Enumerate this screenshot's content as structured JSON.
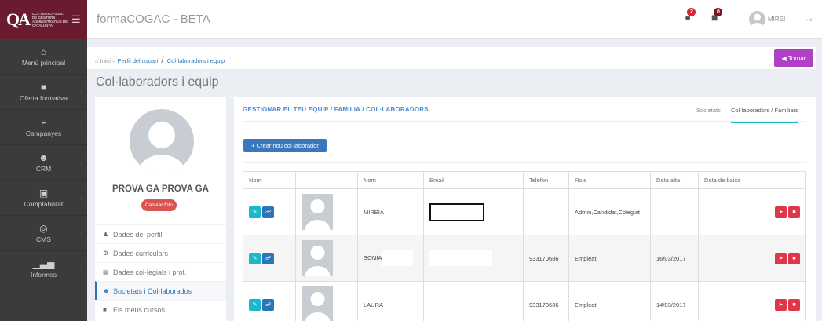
{
  "brand": {
    "mark": "QA",
    "text": "COL·LEGI OFICIAL DE GESTORS ADMINISTRATIUS DE CATALUNYA"
  },
  "app_title": "formaCOGAC - BETA",
  "header": {
    "notif1_count": "2",
    "notif2_count": "0",
    "user": "MIREI",
    "caret": "↓ ∨"
  },
  "sidebar": [
    {
      "icon": "⌂",
      "label": "Menú principal"
    },
    {
      "icon": "■",
      "label": "Oferta formativa"
    },
    {
      "icon": "⌁",
      "label": "Campanyes"
    },
    {
      "icon": "☻",
      "label": "CRM"
    },
    {
      "icon": "▣",
      "label": "Comptabilitat"
    },
    {
      "icon": "◎",
      "label": "CMS"
    },
    {
      "icon": "▁▃▅",
      "label": "Informes"
    }
  ],
  "breadcrumb": {
    "home": "Inici",
    "sep1": ">",
    "item1": "Perfil del usuari",
    "sep2": "/",
    "item2": "Col·laboradors i equip"
  },
  "tornar": "◀ Tornar",
  "page_title": "Col·laboradors i equip",
  "profile": {
    "name": "PROVA GA PROVA GA",
    "change_photo": "Canviar foto",
    "menu": [
      {
        "icon": "♟",
        "label": "Dades del perfil"
      },
      {
        "icon": "⚙",
        "label": "Dades curriculars"
      },
      {
        "icon": "▤",
        "label": "Dades col·legials i prof."
      },
      {
        "icon": "☻",
        "label": "Societats i Col·laborados"
      },
      {
        "icon": "■",
        "label": "Els meus cursos"
      }
    ]
  },
  "panel": {
    "title": "GESTIONAR EL TEU EQUIP / FAMILIA / COL·LABORADORS",
    "tabs": [
      "Societats",
      "Col·laboradors / Familiars"
    ],
    "new_button": "+ Crear nou col·laborador",
    "columns": [
      "Nom",
      "",
      "Nom",
      "Email",
      "Telefon",
      "Rols",
      "Data alta",
      "Data de baixa",
      ""
    ],
    "rows": [
      {
        "name": "MIREIA",
        "email": "",
        "phone": "",
        "roles": "Admin,Candidat,Colegiat",
        "alta": "",
        "baixa": ""
      },
      {
        "name": "SONIA",
        "email": "",
        "phone": "933170686",
        "roles": "Empleat",
        "alta": "16/03/2017",
        "baixa": ""
      },
      {
        "name": "LAURA",
        "email": "",
        "phone": "933170686",
        "roles": "Empleat",
        "alta": "14/03/2017",
        "baixa": ""
      }
    ]
  }
}
